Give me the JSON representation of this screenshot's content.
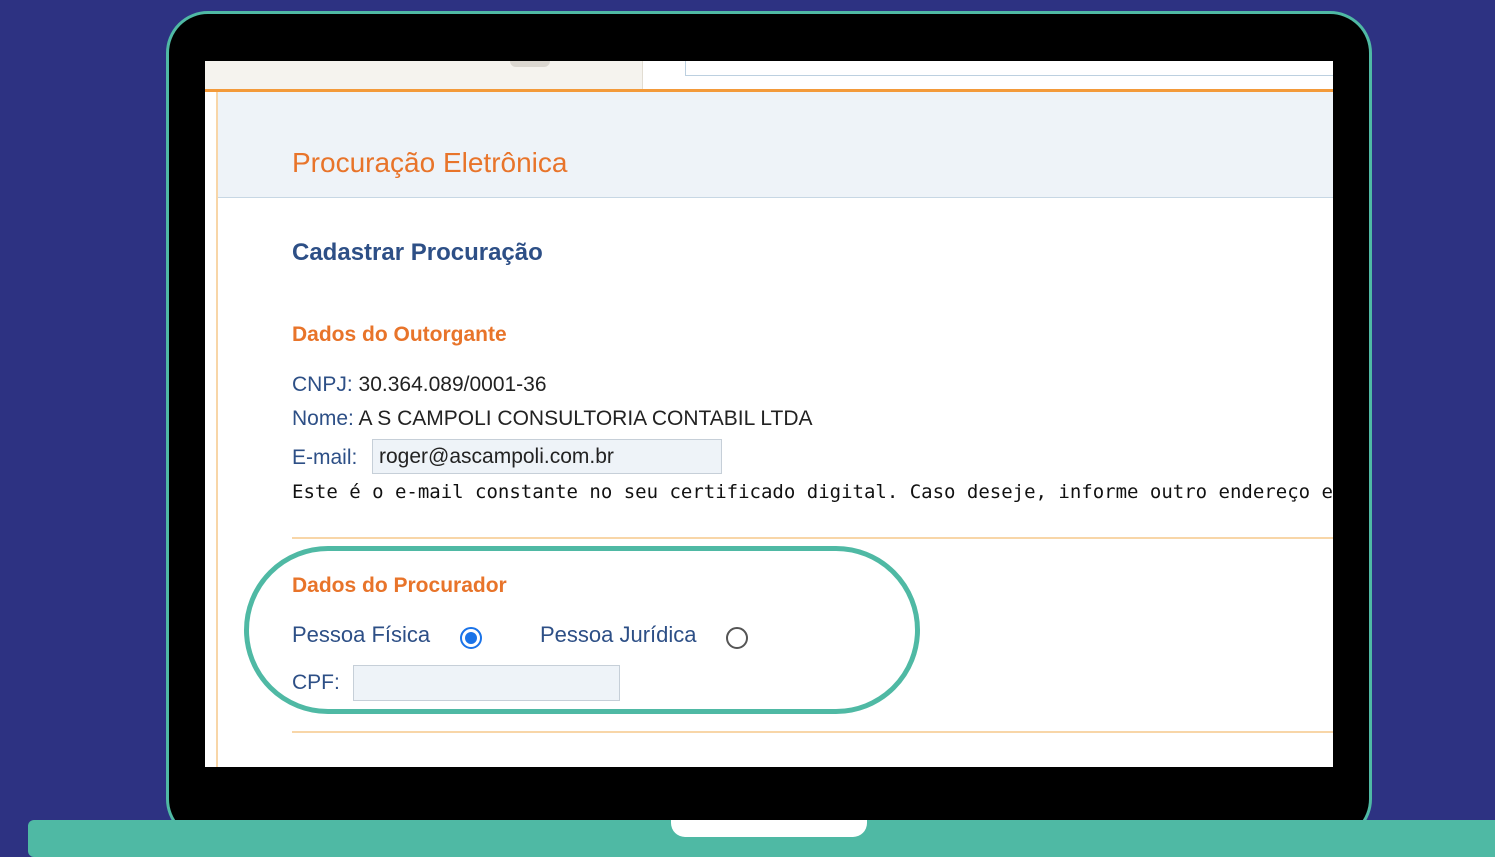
{
  "page": {
    "title": "Procuração Eletrônica",
    "section_title": "Cadastrar Procuração"
  },
  "outorgante": {
    "heading": "Dados do Outorgante",
    "cnpj_label": "CNPJ:",
    "cnpj_value": "30.364.089/0001-36",
    "nome_label": "Nome:",
    "nome_value": "A S CAMPOLI CONSULTORIA CONTABIL LTDA",
    "email_label": "E-mail:",
    "email_value": "roger@ascampoli.com.br",
    "notice": "Este é o e-mail constante no seu certificado digital. Caso deseje, informe outro endereço eletrôni"
  },
  "procurador": {
    "heading": "Dados do Procurador",
    "pessoa_fisica_label": "Pessoa Física",
    "pessoa_juridica_label": "Pessoa Jurídica",
    "selected": "Pessoa Física",
    "cpf_label": "CPF:",
    "cpf_value": ""
  },
  "colors": {
    "background": "#2d3282",
    "laptop_accent": "#4fb9a4",
    "title_orange": "#e8742a",
    "label_blue": "#2d4f86",
    "radio_blue": "#1a73e8"
  }
}
